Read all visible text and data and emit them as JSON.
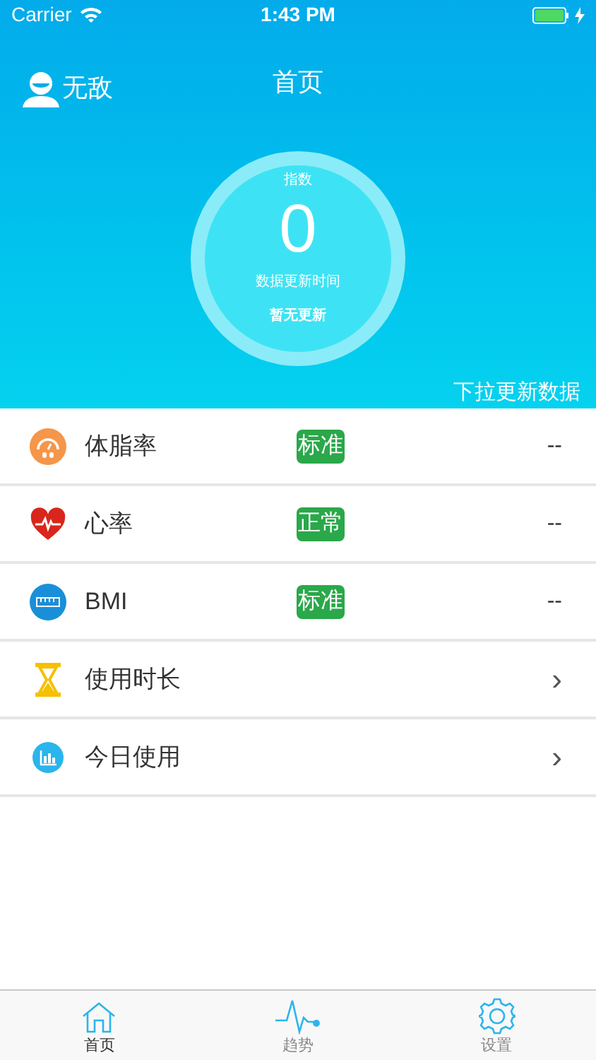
{
  "status_bar": {
    "carrier": "Carrier",
    "time": "1:43 PM"
  },
  "header": {
    "user": "无敌",
    "title": "首页",
    "gauge": {
      "label": "指数",
      "value": "0",
      "caption": "数据更新时间",
      "update": "暂无更新"
    },
    "hint": "下拉更新数据"
  },
  "rows": [
    {
      "kind": "metric",
      "label": "体脂率",
      "badge": "标准",
      "value": "--"
    },
    {
      "kind": "metric",
      "label": "心率",
      "badge": "正常",
      "value": "--"
    },
    {
      "kind": "metric",
      "label": "BMI",
      "badge": "标准",
      "value": "--"
    },
    {
      "kind": "link",
      "label": "使用时长",
      "chevron": "›"
    },
    {
      "kind": "link",
      "label": "今日使用",
      "chevron": "›"
    }
  ],
  "tabs": [
    {
      "label": "首页",
      "selected": true
    },
    {
      "label": "趋势",
      "selected": false
    },
    {
      "label": "设置",
      "selected": false
    }
  ]
}
